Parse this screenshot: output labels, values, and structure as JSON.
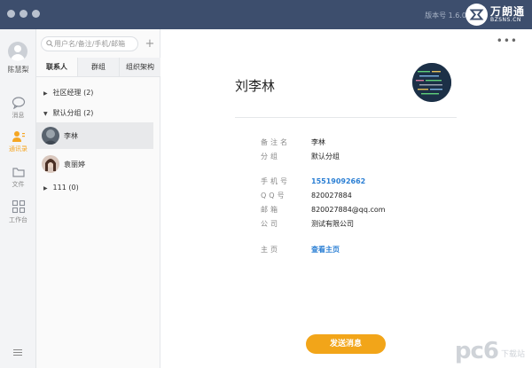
{
  "titlebar": {
    "version": "版本号 1.6.0",
    "brand_name": "万朗通",
    "brand_domain": "BZSNS.CN",
    "bg_color": "#3d4e6d"
  },
  "rail": {
    "user_name": "陈慧梨",
    "items": [
      {
        "label": "消息",
        "icon": "chat-bubble-icon"
      },
      {
        "label": "通讯录",
        "icon": "contacts-icon"
      },
      {
        "label": "文件",
        "icon": "folder-icon"
      },
      {
        "label": "工作台",
        "icon": "apps-grid-icon"
      }
    ],
    "active_index": 1,
    "active_color": "#f5a623"
  },
  "contacts": {
    "search_placeholder": "用户名/备注/手机/邮箱",
    "add_label": "+",
    "tabs": [
      "联系人",
      "群组",
      "组织架构"
    ],
    "active_tab": 0,
    "groups": [
      {
        "arrow": "▶",
        "label": "社区经理 (2)"
      },
      {
        "arrow": "▼",
        "label": "默认分组 (2)"
      },
      {
        "arrow": "▶",
        "label": "111 (0)"
      }
    ],
    "people": [
      {
        "name": "李林",
        "selected": true
      },
      {
        "name": "袁丽婷",
        "selected": false
      }
    ]
  },
  "detail": {
    "more_label": "•••",
    "name": "刘李林",
    "fields": [
      {
        "key": "备注名",
        "value": "李林",
        "link": false
      },
      {
        "key": "分组",
        "value": "默认分组",
        "link": false
      },
      {
        "key": "手机号",
        "value": "15519092662",
        "link": true
      },
      {
        "key": "QQ号",
        "value": "820027884",
        "link": false
      },
      {
        "key": "邮箱",
        "value": "820027884@qq.com",
        "link": false
      },
      {
        "key": "公司",
        "value": "测试有限公司",
        "link": false
      },
      {
        "key": "主页",
        "value": "查看主页",
        "link": true
      }
    ],
    "send_button": "发送消息",
    "accent_color": "#f2a519",
    "link_color": "#2b7fd4"
  },
  "watermark": {
    "big": "pc6",
    "small": "下载站"
  }
}
